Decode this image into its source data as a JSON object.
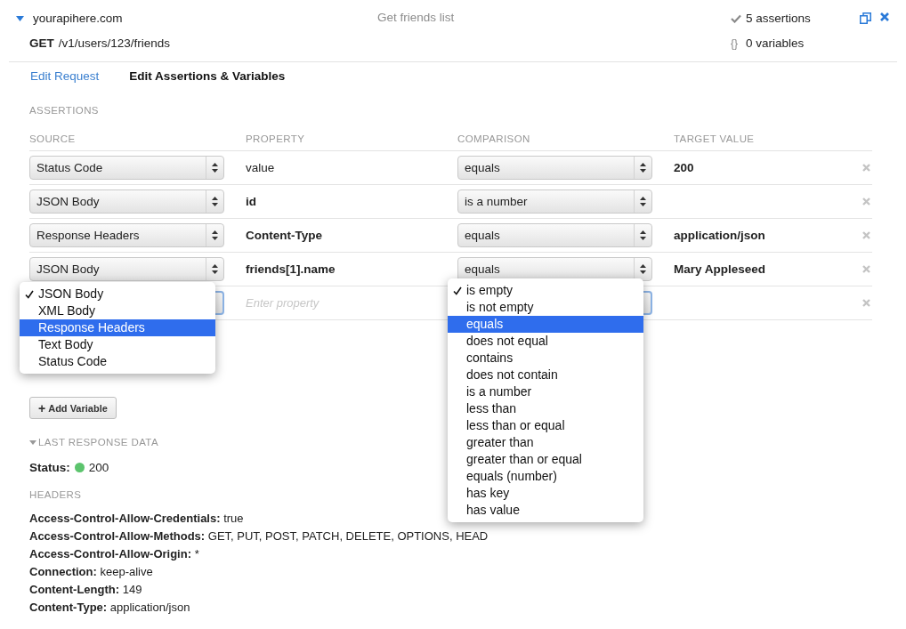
{
  "request": {
    "host": "yourapihere.com",
    "expanded": true,
    "name": "Get friends list",
    "method": "GET",
    "path": "/v1/users/123/friends",
    "assertions_count": "5 assertions",
    "variables_icon": "{}",
    "variables_count": "0 variables"
  },
  "tabs": [
    {
      "label": "Edit Request",
      "selected": false
    },
    {
      "label": "Edit Assertions & Variables",
      "selected": true
    }
  ],
  "assertions": {
    "title": "ASSERTIONS",
    "columns": [
      "SOURCE",
      "PROPERTY",
      "COMPARISON",
      "TARGET VALUE"
    ],
    "rows": [
      {
        "source": "Status Code",
        "property": "value",
        "property_bold": false,
        "comparison": "equals",
        "target": "200"
      },
      {
        "source": "JSON Body",
        "property": "id",
        "property_bold": true,
        "comparison": "is a number"
      },
      {
        "source": "Response Headers",
        "property": "Content-Type",
        "property_bold": true,
        "comparison": "equals",
        "target": "application/json"
      },
      {
        "source": "JSON Body",
        "property": "friends[1].name",
        "property_bold": true,
        "comparison": "equals",
        "target": "Mary Appleseed"
      }
    ],
    "new_row": {
      "property_placeholder": "Enter property",
      "source_menu": [
        {
          "label": "JSON Body",
          "checked": true,
          "selected": false
        },
        {
          "label": "XML Body",
          "checked": false,
          "selected": false
        },
        {
          "label": "Response Headers",
          "checked": false,
          "selected": true
        },
        {
          "label": "Text Body",
          "checked": false,
          "selected": false
        },
        {
          "label": "Status Code",
          "checked": false,
          "selected": false
        }
      ],
      "comparison_menu": [
        {
          "label": "is empty",
          "checked": true,
          "selected": false
        },
        {
          "label": "is not empty",
          "checked": false,
          "selected": false
        },
        {
          "label": "equals",
          "checked": false,
          "selected": true
        },
        {
          "label": "does not equal",
          "checked": false,
          "selected": false
        },
        {
          "label": "contains",
          "checked": false,
          "selected": false
        },
        {
          "label": "does not contain",
          "checked": false,
          "selected": false
        },
        {
          "label": "is a number",
          "checked": false,
          "selected": false
        },
        {
          "label": "less than",
          "checked": false,
          "selected": false
        },
        {
          "label": "less than or equal",
          "checked": false,
          "selected": false
        },
        {
          "label": "greater than",
          "checked": false,
          "selected": false
        },
        {
          "label": "greater than or equal",
          "checked": false,
          "selected": false
        },
        {
          "label": "equals (number)",
          "checked": false,
          "selected": false
        },
        {
          "label": "has key",
          "checked": false,
          "selected": false
        },
        {
          "label": "has value",
          "checked": false,
          "selected": false
        }
      ]
    }
  },
  "add_variable": {
    "icon": "+",
    "label": "Add Variable"
  },
  "last_response": {
    "title": "LAST RESPONSE DATA",
    "expanded": true,
    "status_label": "Status:",
    "status_code": "200",
    "headers_title": "HEADERS",
    "headers": [
      {
        "name": "Access-Control-Allow-Credentials:",
        "value": "true"
      },
      {
        "name": "Access-Control-Allow-Methods:",
        "value": "GET, PUT, POST, PATCH, DELETE, OPTIONS, HEAD"
      },
      {
        "name": "Access-Control-Allow-Origin:",
        "value": "*"
      },
      {
        "name": "Connection:",
        "value": "keep-alive"
      },
      {
        "name": "Content-Length:",
        "value": "149"
      },
      {
        "name": "Content-Type:",
        "value": "application/json"
      }
    ]
  }
}
